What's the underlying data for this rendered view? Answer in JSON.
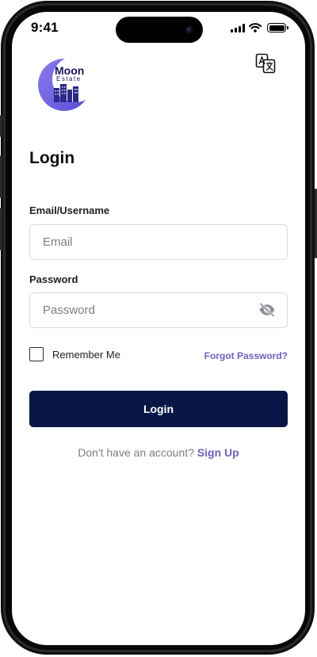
{
  "status_bar": {
    "time": "9:41"
  },
  "header": {
    "logo_top": "Moon",
    "logo_bottom": "Estate",
    "logo_icon": "moon-estate-logo",
    "translate_icon": "translate-icon"
  },
  "login": {
    "title": "Login",
    "email_label": "Email/Username",
    "email_placeholder": "Email",
    "email_value": "",
    "password_label": "Password",
    "password_placeholder": "Password",
    "password_value": "",
    "password_visibility_icon": "eye-off-icon",
    "remember_label": "Remember Me",
    "remember_checked": false,
    "forgot_label": "Forgot Password?",
    "submit_label": "Login",
    "signup_prompt": "Don't have an account?",
    "signup_label": "Sign Up"
  },
  "colors": {
    "primary": "#0a1746",
    "accent": "#6c5fc7",
    "logo": "#7b68ee"
  }
}
